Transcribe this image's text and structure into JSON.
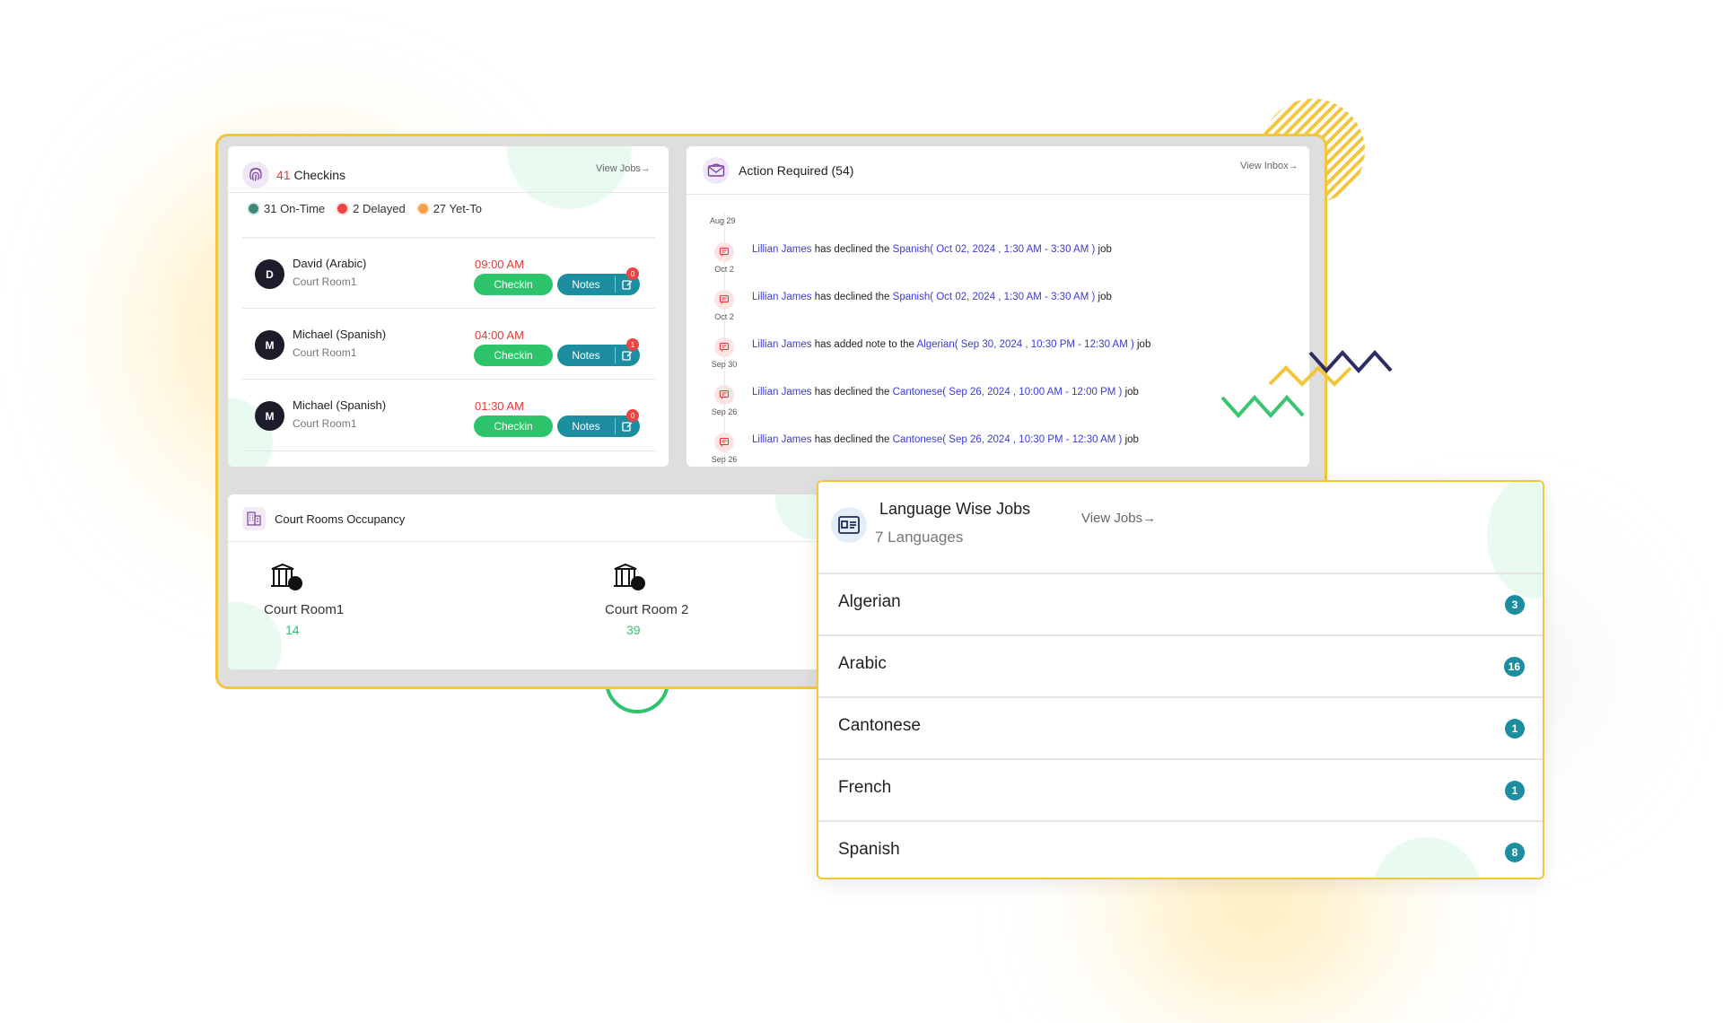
{
  "checkins": {
    "count": "41",
    "label": "Checkins",
    "view_link": "View Jobs→",
    "legend": [
      {
        "text": "31 On-Time",
        "color": "#3d8a7a"
      },
      {
        "text": "2 Delayed",
        "color": "#ef4444"
      },
      {
        "text": "27 Yet-To",
        "color": "#f6a04d"
      }
    ],
    "rows": [
      {
        "initial": "D",
        "name": "David (Arabic)",
        "room": "Court Room1",
        "time": "09:00 AM",
        "checkin_label": "Checkin",
        "notes_label": "Notes",
        "badge": "0"
      },
      {
        "initial": "M",
        "name": "Michael (Spanish)",
        "room": "Court Room1",
        "time": "04:00 AM",
        "checkin_label": "Checkin",
        "notes_label": "Notes",
        "badge": "1"
      },
      {
        "initial": "M",
        "name": "Michael (Spanish)",
        "room": "Court Room1",
        "time": "01:30 AM",
        "checkin_label": "Checkin",
        "notes_label": "Notes",
        "badge": "0"
      }
    ]
  },
  "action": {
    "title": "Action Required (54)",
    "view_link": "View Inbox→",
    "top_date": "Aug 29",
    "items": [
      {
        "user": "Lillian James",
        "verb": "has declined the",
        "job": "Spanish( Oct 02, 2024 , 1:30 AM - 3:30 AM )",
        "suffix": "job",
        "date": "Oct 2"
      },
      {
        "user": "Lillian James",
        "verb": "has declined the",
        "job": "Spanish( Oct 02, 2024 , 1:30 AM - 3:30 AM )",
        "suffix": "job",
        "date": "Oct 2"
      },
      {
        "user": "Lillian James",
        "verb": "has added note to the",
        "job": "Algerian( Sep 30, 2024 , 10:30 PM - 12:30 AM )",
        "suffix": "job",
        "date": "Sep 30"
      },
      {
        "user": "Lillian James",
        "verb": "has declined the",
        "job": "Cantonese( Sep 26, 2024 , 10:00 AM - 12:00 PM )",
        "suffix": "job",
        "date": "Sep 26"
      },
      {
        "user": "Lillian James",
        "verb": "has declined the",
        "job": "Cantonese( Sep 26, 2024 , 10:30 PM - 12:30 AM )",
        "suffix": "job",
        "date": "Sep 26"
      }
    ]
  },
  "court": {
    "title": "Court Rooms Occupancy",
    "rooms": [
      {
        "name": "Court Room1",
        "count": "14"
      },
      {
        "name": "Court Room 2",
        "count": "39"
      }
    ]
  },
  "languages": {
    "title": "Language Wise Jobs",
    "subtitle": "7 Languages",
    "view_link": "View Jobs→",
    "items": [
      {
        "name": "Algerian",
        "count": "3"
      },
      {
        "name": "Arabic",
        "count": "16"
      },
      {
        "name": "Cantonese",
        "count": "1"
      },
      {
        "name": "French",
        "count": "1"
      },
      {
        "name": "Spanish",
        "count": "8"
      }
    ]
  },
  "colors": {
    "accent_green": "#2ec46c",
    "accent_teal": "#1d8ea0",
    "accent_red": "#e53935",
    "frame_yellow": "#f3c63f",
    "link_blue": "#3b3bd6"
  }
}
